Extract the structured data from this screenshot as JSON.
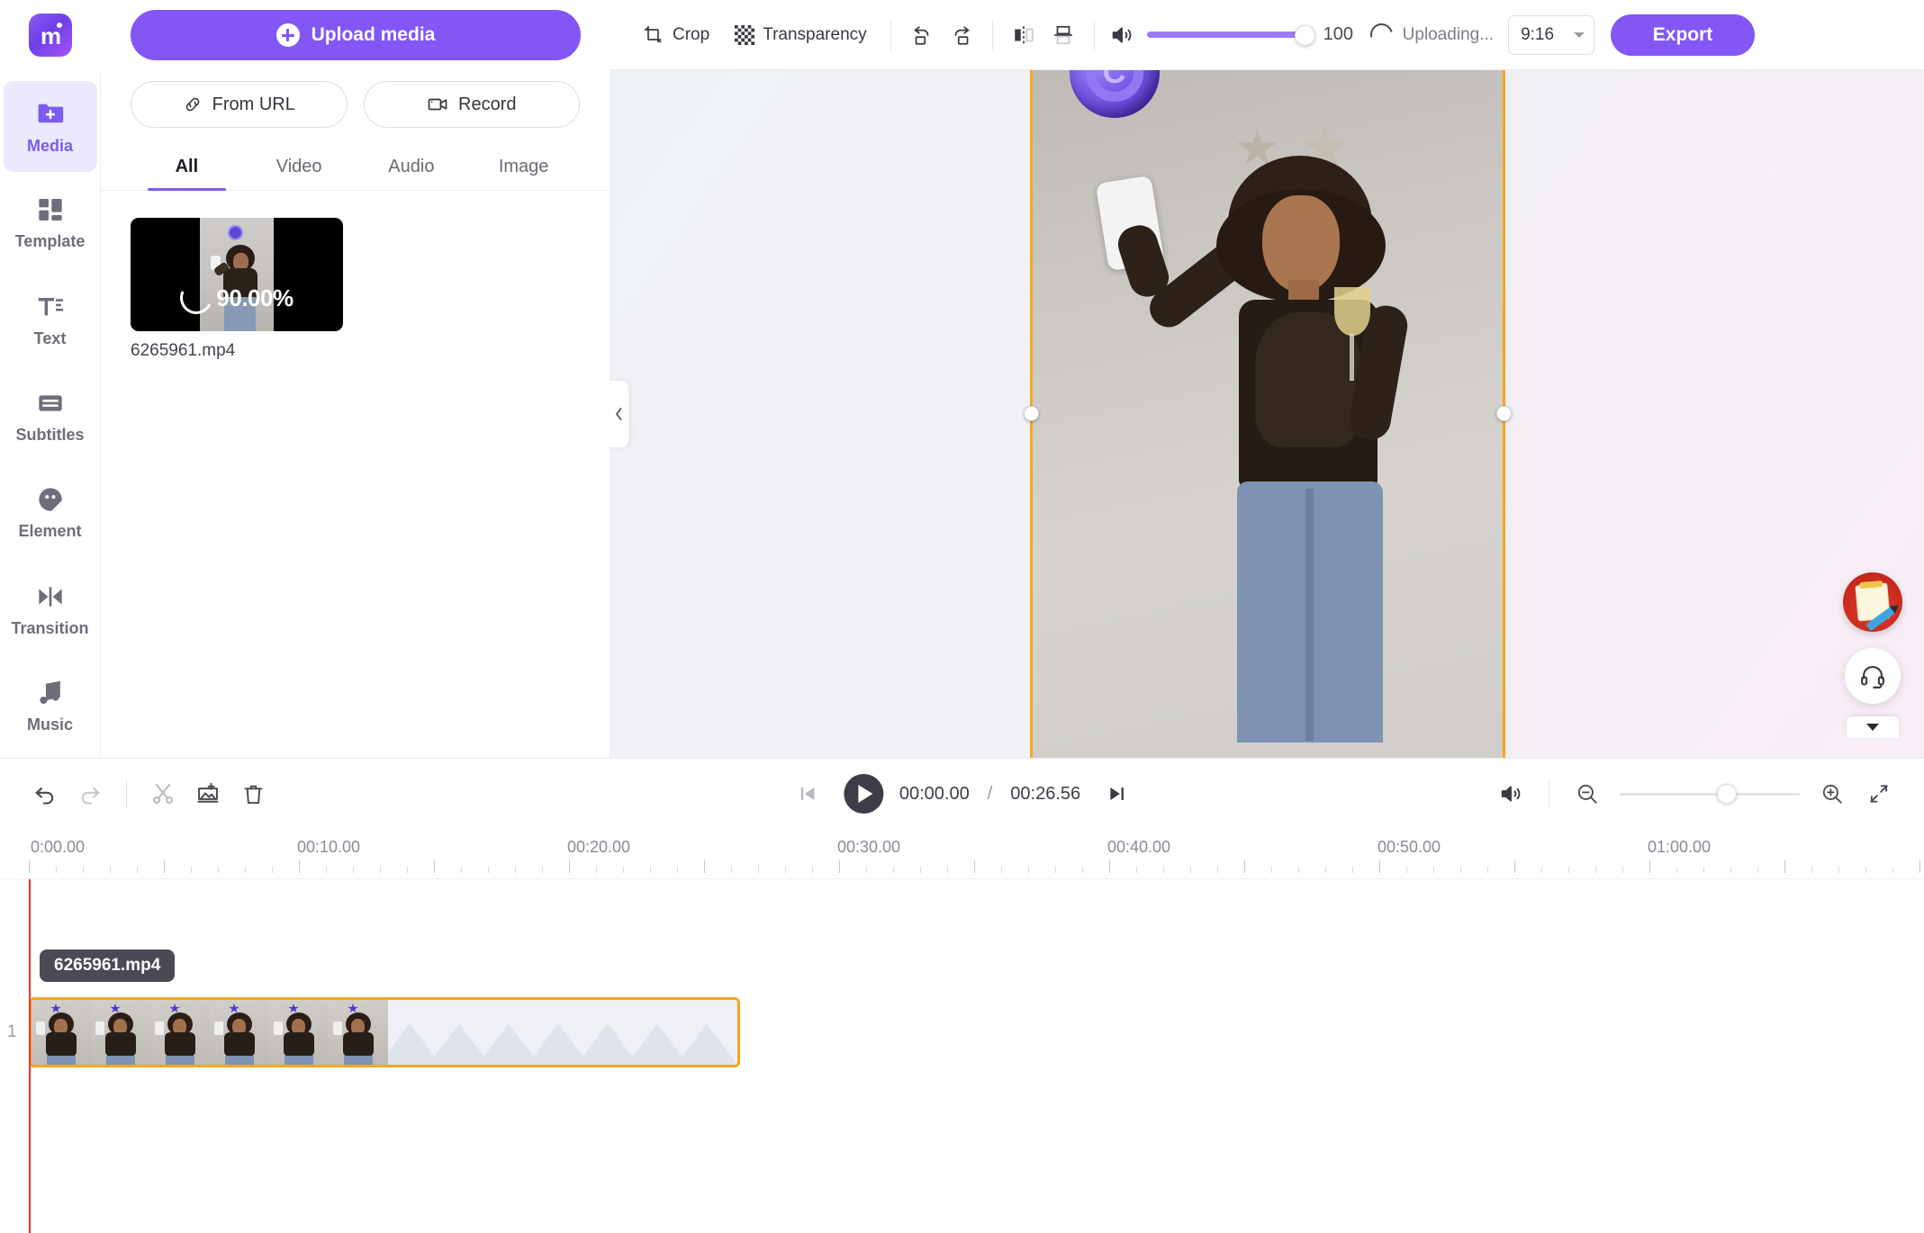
{
  "app": {
    "logo_letter": "m"
  },
  "media_panel": {
    "upload_button": "Upload media",
    "from_url_button": "From URL",
    "record_button": "Record",
    "tabs": [
      {
        "label": "All",
        "active": true
      },
      {
        "label": "Video",
        "active": false
      },
      {
        "label": "Audio",
        "active": false
      },
      {
        "label": "Image",
        "active": false
      }
    ],
    "items": [
      {
        "name": "6265961.mp4",
        "progress": "90.00%"
      }
    ]
  },
  "sidebar": {
    "items": [
      {
        "label": "Media",
        "icon": "media-folder-icon",
        "active": true
      },
      {
        "label": "Template",
        "icon": "template-grid-icon",
        "active": false
      },
      {
        "label": "Text",
        "icon": "text-icon",
        "active": false
      },
      {
        "label": "Subtitles",
        "icon": "subtitles-icon",
        "active": false
      },
      {
        "label": "Element",
        "icon": "element-sticker-icon",
        "active": false
      },
      {
        "label": "Transition",
        "icon": "transition-icon",
        "active": false
      },
      {
        "label": "Music",
        "icon": "music-note-icon",
        "active": false
      }
    ]
  },
  "toolbar": {
    "crop_label": "Crop",
    "transparency_label": "Transparency",
    "rotate_left_label": "rotate-left",
    "rotate_right_label": "rotate-right",
    "flip_horizontal_label": "flip-horizontal",
    "flip_vertical_label": "flip-vertical",
    "volume_value": "100",
    "upload_status": "Uploading...",
    "aspect_ratio": "9:16",
    "export_label": "Export"
  },
  "canvas": {
    "watermark_letter": "C"
  },
  "timeline": {
    "current_time": "00:00.00",
    "separator": "/",
    "total_time": "00:26.56",
    "track_number": "1",
    "clip_label": "6265961.mp4",
    "ruler_labels": [
      "0:00.00",
      "00:10.00",
      "00:20.00",
      "00:30.00",
      "00:40.00",
      "00:50.00",
      "01:00.00"
    ]
  },
  "colors": {
    "accent": "#8257f5",
    "selection": "#f5a623",
    "playhead": "#f0352e",
    "active_bg": "#ece8fd"
  }
}
